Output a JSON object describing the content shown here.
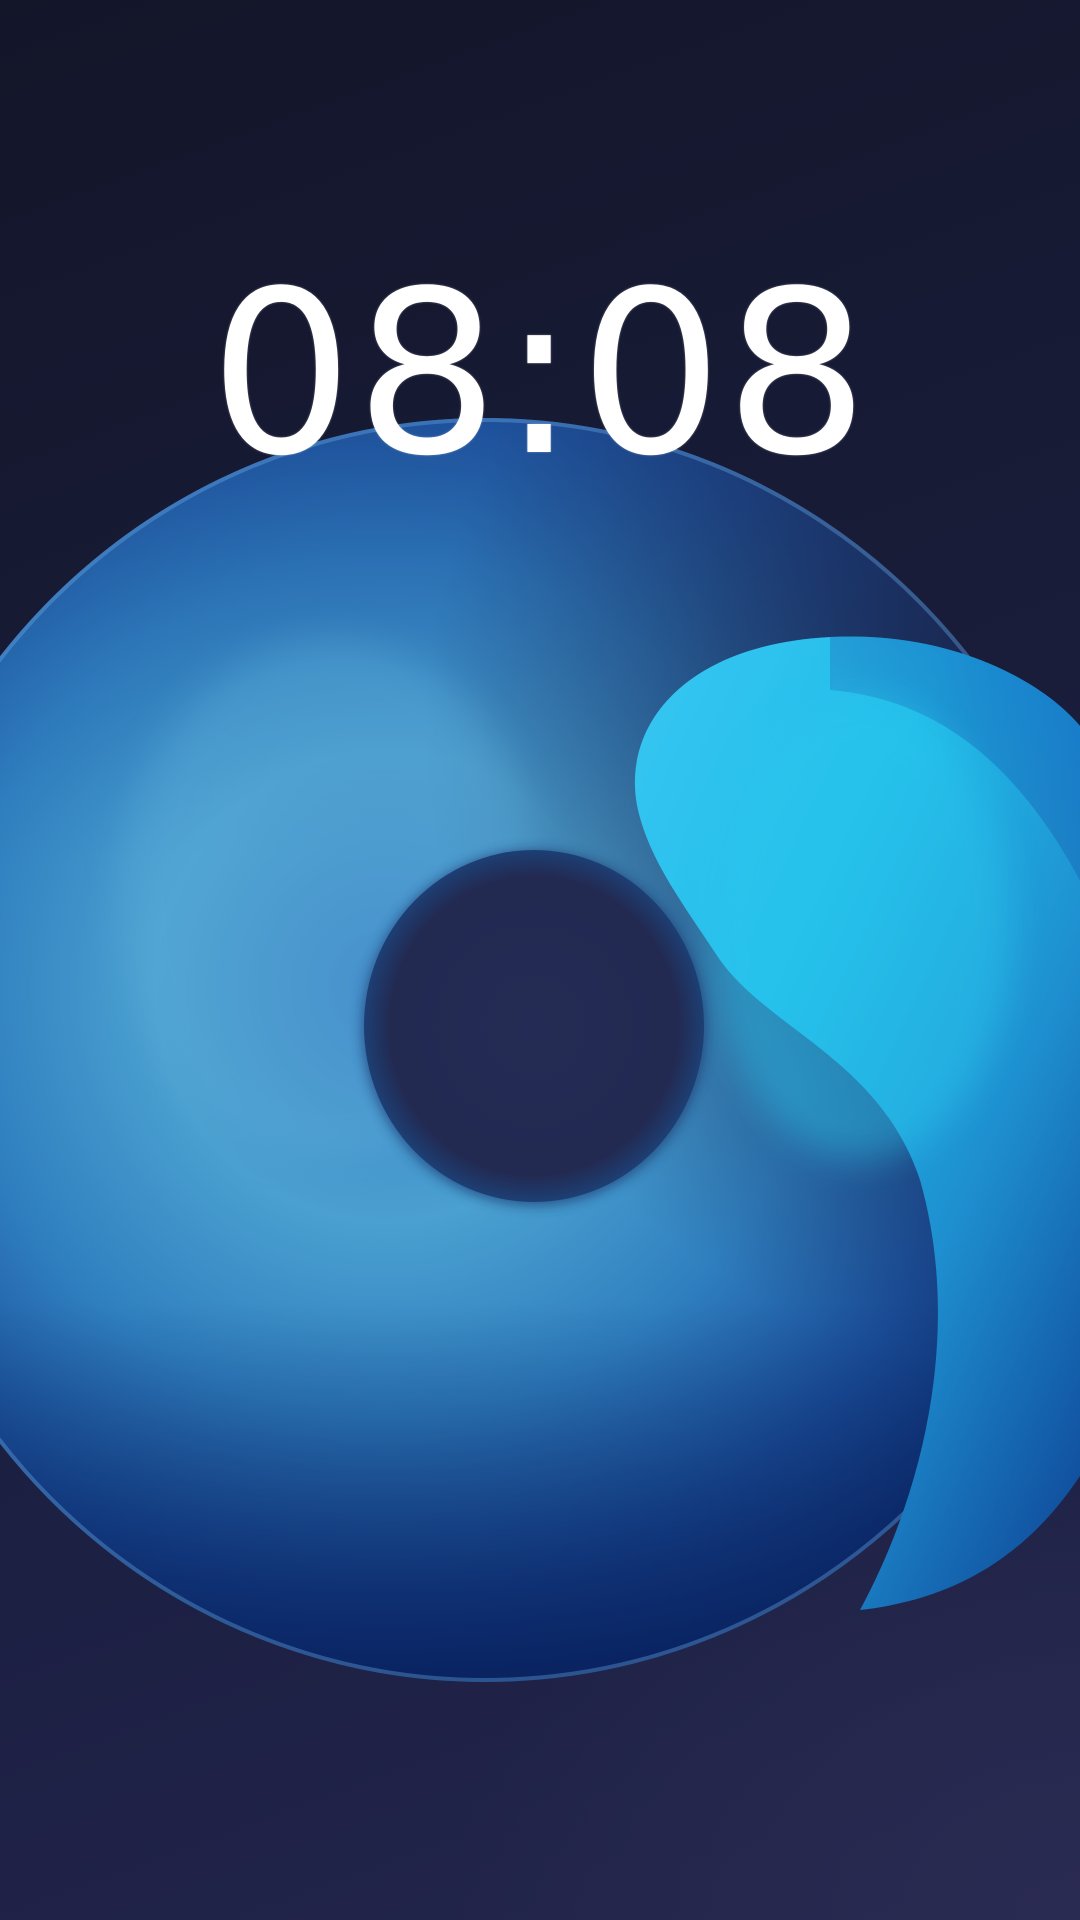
{
  "lock_screen": {
    "time": "08:08"
  },
  "wallpaper": {
    "type": "abstract-blue-torus",
    "colors": {
      "background_dark": "#14162b",
      "torus_deep_blue": "#0b2a6b",
      "torus_light_blue": "#4aa3d6",
      "swirl_cyan": "#27c3ef",
      "hole": "#222b50"
    }
  }
}
